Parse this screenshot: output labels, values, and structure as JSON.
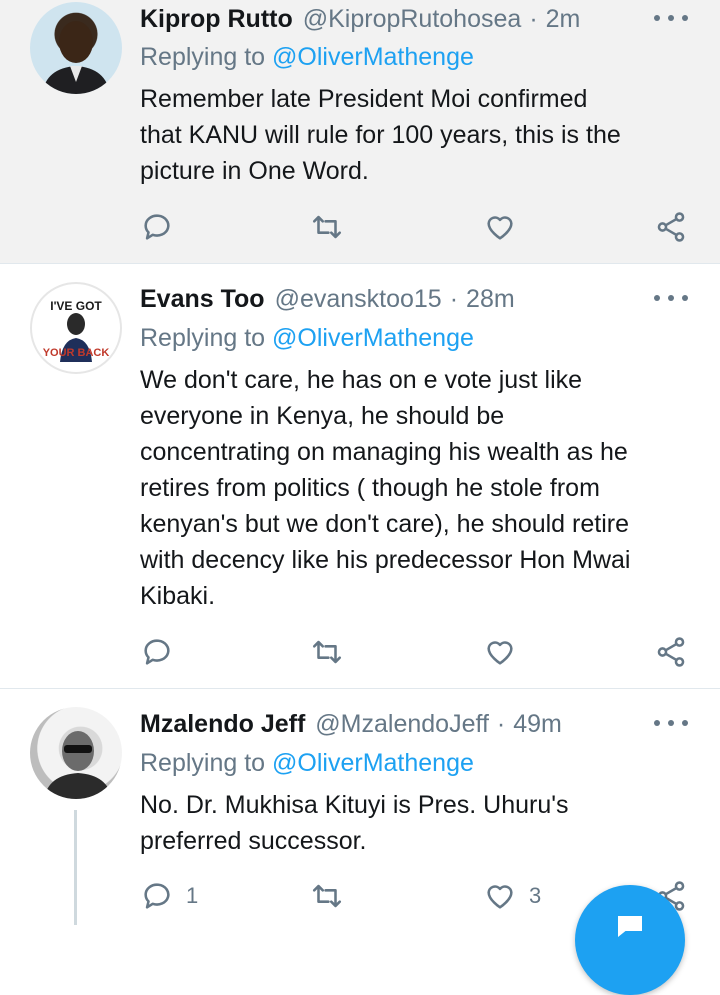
{
  "tweets": [
    {
      "name": "Kiprop Rutto",
      "handle": "@KipropRutohosea",
      "time": "2m",
      "replying_prefix": "Replying to ",
      "replying_to": "@OliverMathenge",
      "text": "Remember late President Moi confirmed\nthat KANU will rule for 100 years, this is the\npicture in One Word.",
      "reply_count": "",
      "like_count": ""
    },
    {
      "name": "Evans Too",
      "handle": "@evansktoo15",
      "time": "28m",
      "replying_prefix": "Replying to ",
      "replying_to": "@OliverMathenge",
      "text": "We don't care, he has on e vote just like\neveryone in Kenya, he should be\nconcentrating on managing his wealth as he\nretires from politics ( though he stole from\nkenyan's but we don't care), he should retire\nwith decency like his predecessor Hon Mwai\nKibaki.",
      "reply_count": "",
      "like_count": "",
      "avatar_text": [
        "I'VE GOT",
        "YOUR BACK"
      ]
    },
    {
      "name": "Mzalendo Jeff",
      "handle": "@MzalendoJeff",
      "time": "49m",
      "replying_prefix": "Replying to ",
      "replying_to": "@OliverMathenge",
      "text": "No. Dr. Mukhisa Kituyi is Pres. Uhuru's\npreferred successor.",
      "reply_count": "1",
      "like_count": "3"
    }
  ],
  "separator": "·",
  "colors": {
    "accent": "#1da1f2",
    "secondary_text": "#657786",
    "primary_text": "#14171a",
    "highlight_bg": "#f2f2f2"
  },
  "icons": [
    "reply-icon",
    "retweet-icon",
    "like-icon",
    "share-icon",
    "more-icon",
    "compose-icon"
  ]
}
